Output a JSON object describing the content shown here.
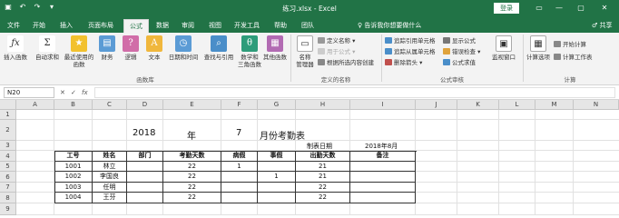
{
  "titlebar": {
    "filename": "练习.xlsx",
    "sep": " - ",
    "app": "Excel",
    "login": "登录",
    "qat": {
      "save": "▣",
      "undo": "↶",
      "redo": "↷",
      "more": "▾"
    },
    "controls": {
      "ribbon_opts": "▭",
      "minimize": "—",
      "restore": "▢",
      "close": "✕"
    }
  },
  "tabs": [
    "文件",
    "开始",
    "插入",
    "页面布局",
    "公式",
    "数据",
    "审阅",
    "视图",
    "开发工具",
    "帮助",
    "团队"
  ],
  "active_tab": "公式",
  "tell_me": "♀ 告诉我你想要做什么",
  "share": "♂ 共享",
  "ribbon": {
    "function_library": {
      "insert_function": "插入函数",
      "autosum": "自动求和",
      "recent": "最近使用的",
      "recent2": "函数",
      "financial": "财务",
      "logical": "逻辑",
      "text": "文本",
      "datetime": "日期和时间",
      "lookup": "查找与引用",
      "math": "数学和",
      "math2": "三角函数",
      "more": "其他函数",
      "group_label": "函数库"
    },
    "defined_names": {
      "name_manager": "名称",
      "name_manager2": "管理器",
      "define_name": "定义名称 ▾",
      "use_in_formula": "用于公式 ▾",
      "create_from_selection": "根据所选内容创建",
      "group_label": "定义的名称"
    },
    "formula_auditing": {
      "trace_precedents": "追踪引用单元格",
      "trace_dependents": "追踪从属单元格",
      "remove_arrows": "删除箭头 ▾",
      "show_formulas": "显示公式",
      "error_checking": "错误检查 ▾",
      "evaluate_formula": "公式求值",
      "watch_window": "监视窗口",
      "group_label": "公式审核"
    },
    "calculation": {
      "calc_options": "计算选项",
      "calc_now": "开始计算",
      "calc_sheet": "计算工作表",
      "group_label": "计算"
    }
  },
  "formula_bar": {
    "name_box": "N20",
    "cancel": "✕",
    "enter": "✓",
    "fx": "fx",
    "value": ""
  },
  "sheet": {
    "columns": [
      "A",
      "B",
      "C",
      "D",
      "E",
      "F",
      "G",
      "H",
      "I",
      "J",
      "K",
      "L",
      "M",
      "N"
    ],
    "rows": [
      "1",
      "2",
      "3",
      "4",
      "5",
      "6",
      "7",
      "8",
      "9"
    ],
    "title_year": "2018",
    "title_nian": "年",
    "title_month": "7",
    "title_text": "月份考勤表",
    "made_date_label": "制表日期",
    "made_date_value": "2018年8月",
    "headers": [
      "工号",
      "姓名",
      "部门",
      "考勤天数",
      "病假",
      "事假",
      "出勤天数",
      "备注"
    ],
    "records": [
      [
        "1001",
        "林立",
        "",
        "22",
        "1",
        "",
        "21",
        ""
      ],
      [
        "1002",
        "李国良",
        "",
        "22",
        "",
        "1",
        "21",
        ""
      ],
      [
        "1003",
        "任明",
        "",
        "22",
        "",
        "",
        "22",
        ""
      ],
      [
        "1004",
        "王芬",
        "",
        "22",
        "",
        "",
        "22",
        ""
      ]
    ]
  },
  "colors": {
    "brand": "#217346",
    "ribbon_bg": "#f3f3f3",
    "grid_line": "#e1e1e1",
    "header_bg": "#e6e6e6"
  }
}
